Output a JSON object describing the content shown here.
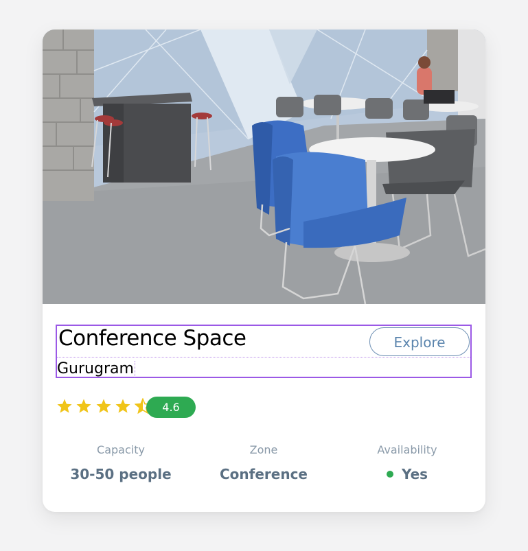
{
  "card": {
    "title": "Conference Space",
    "location": "Gurugram",
    "explore_label": "Explore",
    "rating": 4.6,
    "rating_label": "4.6",
    "rating_color": "#2eaa52",
    "star_color": "#f0c419",
    "accent_color": "#5a84ad",
    "stats": [
      {
        "label": "Capacity",
        "value": "30-50 people"
      },
      {
        "label": "Zone",
        "value": "Conference"
      },
      {
        "label": "Availability",
        "value": "Yes",
        "indicator_color": "#2eaa52"
      }
    ]
  }
}
